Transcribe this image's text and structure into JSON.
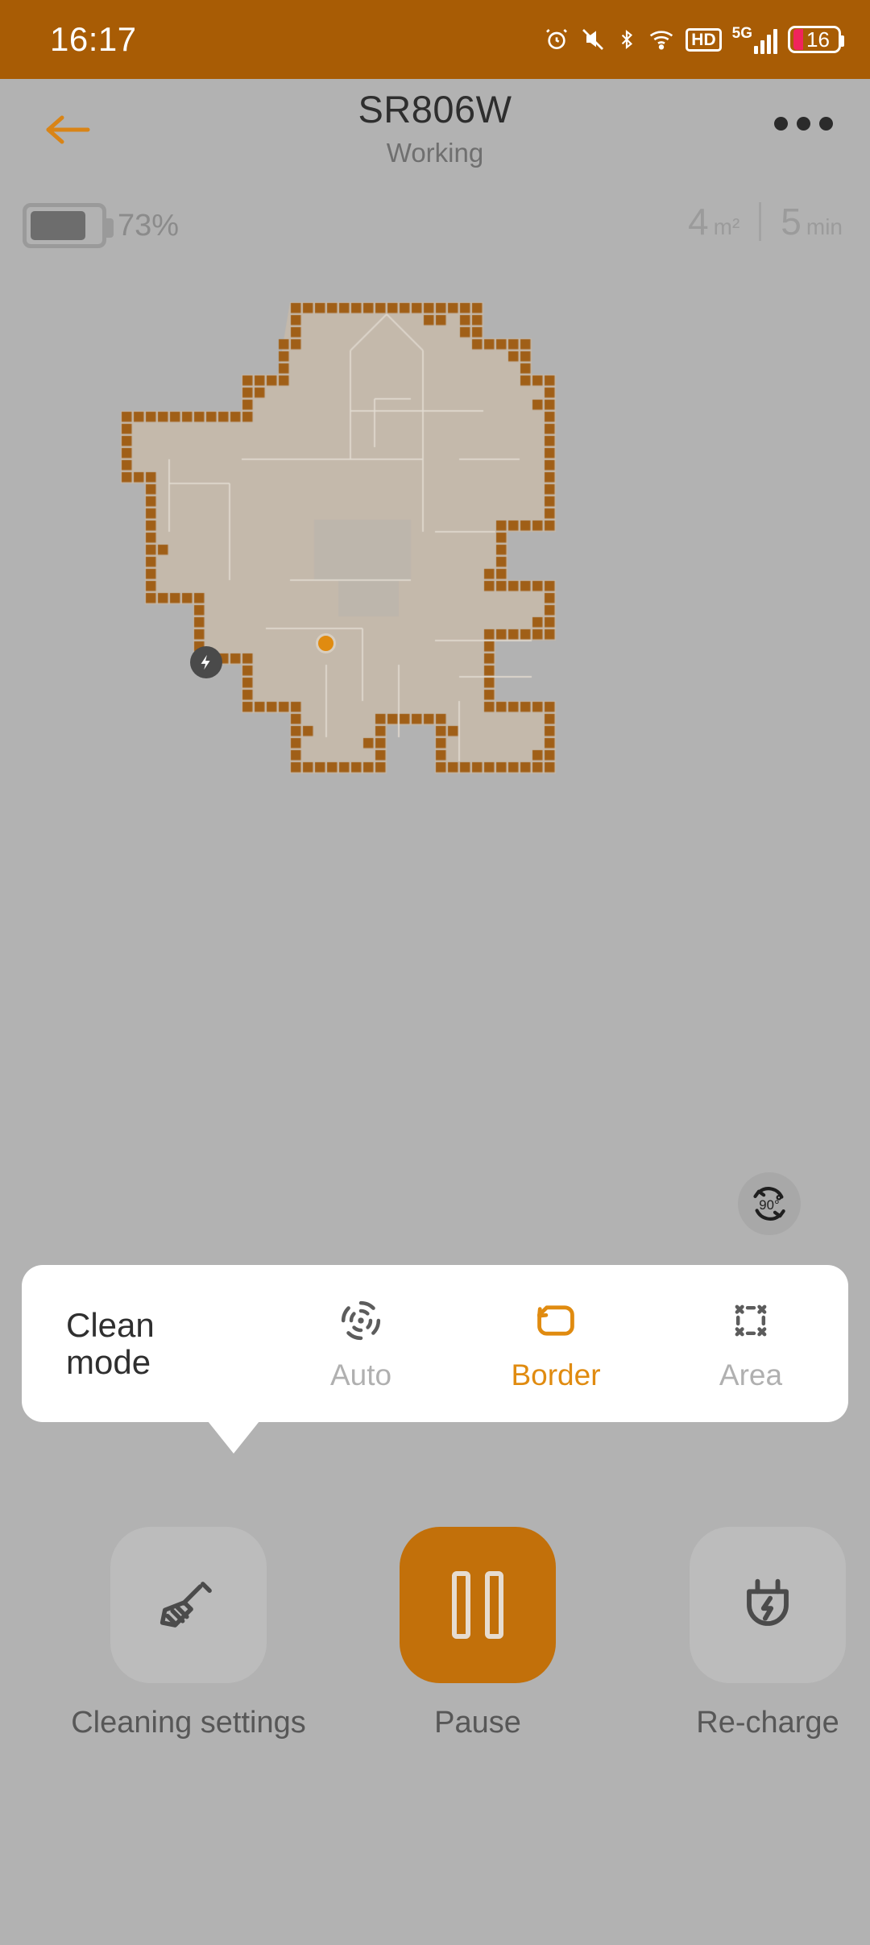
{
  "status_bar": {
    "time": "16:17",
    "battery_level": "16",
    "network_label": "5G",
    "hd_label": "HD",
    "icons": [
      "alarm-icon",
      "mute-icon",
      "bluetooth-icon",
      "wifi-icon",
      "hd-icon",
      "signal-icon",
      "battery-icon"
    ],
    "background_color": "#a85c05"
  },
  "header": {
    "title": "SR806W",
    "subtitle": "Working",
    "back_icon": "back-arrow-icon",
    "menu_icon": "overflow-menu-icon",
    "accent_color": "#d98416"
  },
  "stats": {
    "battery_percent": "73%",
    "area_value": "4",
    "area_unit": "m²",
    "time_value": "5",
    "time_unit": "min"
  },
  "map": {
    "dock_icon": "charging-dock-icon",
    "robot_icon": "robot-position-dot",
    "floor_color": "#c4b9ab",
    "wall_color": "#a05f17",
    "background_color": "#b2b2b2",
    "cell": 15
  },
  "rotate_button": {
    "label": "90°",
    "icon": "rotate-90-icon"
  },
  "clean_mode": {
    "label_line1": "Clean",
    "label_line2": "mode",
    "selected": "Border",
    "modes": [
      {
        "label": "Auto",
        "icon": "auto-clean-icon",
        "active": false
      },
      {
        "label": "Border",
        "icon": "border-clean-icon",
        "active": true
      },
      {
        "label": "Area",
        "icon": "area-clean-icon",
        "active": false
      }
    ]
  },
  "controls": [
    {
      "label": "Cleaning settings",
      "icon": "broom-icon",
      "style": "plain"
    },
    {
      "label": "Pause",
      "icon": "pause-icon",
      "style": "accent"
    },
    {
      "label": "Re-charge",
      "icon": "plug-icon",
      "style": "plain"
    }
  ]
}
